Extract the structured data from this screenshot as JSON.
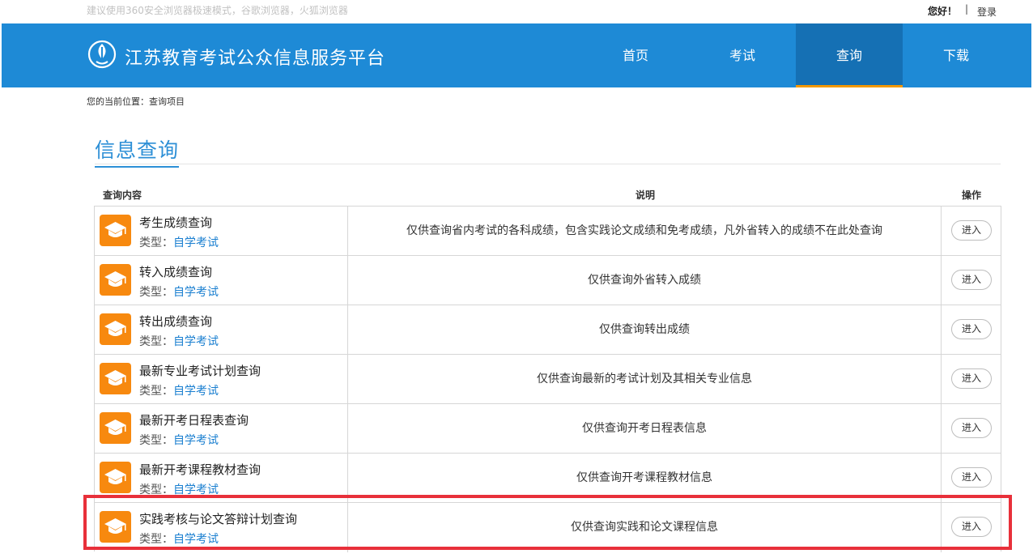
{
  "topbar": {
    "hint": "建议使用360安全浏览器极速模式，谷歌浏览器，火狐浏览器",
    "greeting": "您好！",
    "separator": "|",
    "login": "登录"
  },
  "header": {
    "site_title": "江苏教育考试公众信息服务平台",
    "nav": [
      "首页",
      "考试",
      "查询",
      "下载"
    ],
    "active_nav": "查询"
  },
  "breadcrumb": "您的当前位置：查询项目",
  "section_title": "信息查询",
  "table": {
    "headers": {
      "content": "查询内容",
      "desc": "说明",
      "action": "操作"
    },
    "type_label": "类型：",
    "enter_label": "进入",
    "rows": [
      {
        "name": "考生成绩查询",
        "type": "自学考试",
        "desc": "仅供查询省内考试的各科成绩，包含实践论文成绩和免考成绩，凡外省转入的成绩不在此处查询"
      },
      {
        "name": "转入成绩查询",
        "type": "自学考试",
        "desc": "仅供查询外省转入成绩"
      },
      {
        "name": "转出成绩查询",
        "type": "自学考试",
        "desc": "仅供查询转出成绩"
      },
      {
        "name": "最新专业考试计划查询",
        "type": "自学考试",
        "desc": "仅供查询最新的考试计划及其相关专业信息"
      },
      {
        "name": "最新开考日程表查询",
        "type": "自学考试",
        "desc": "仅供查询开考日程表信息"
      },
      {
        "name": "最新开考课程教材查询",
        "type": "自学考试",
        "desc": "仅供查询开考课程教材信息"
      },
      {
        "name": "实践考核与论文答辩计划查询",
        "type": "自学考试",
        "desc": "仅供查询实践和论文课程信息"
      }
    ]
  },
  "colors": {
    "header_bg": "#1e8ad6",
    "nav_active_bg": "#1570b4",
    "nav_active_underline": "#f39800",
    "icon_bg": "#f7890f",
    "link": "#1a7fd0",
    "highlight": "#e8303a"
  },
  "icons": {
    "logo": "emblem-icon",
    "row": "graduation-cap-icon"
  },
  "highlighted_row": 6
}
